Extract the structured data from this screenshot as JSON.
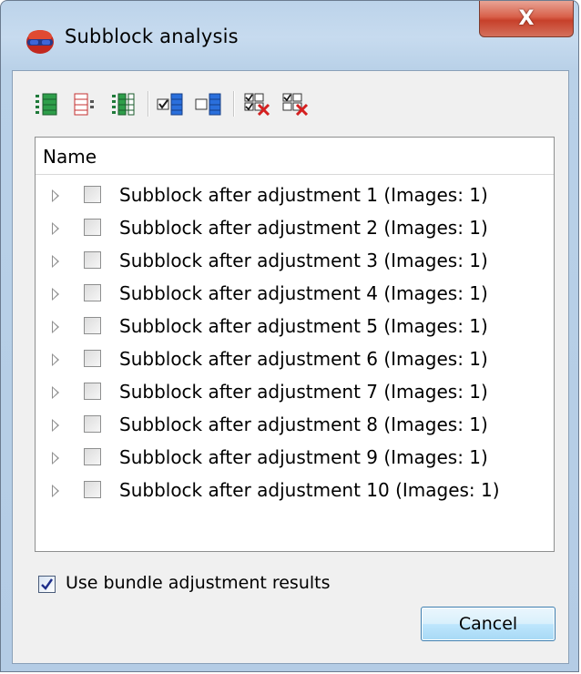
{
  "window": {
    "title": "Subblock analysis",
    "close_label": "X"
  },
  "toolbar": {
    "buttons": [
      {
        "icon": "expand-all-icon"
      },
      {
        "icon": "collapse-all-icon"
      },
      {
        "icon": "expand-tree-icon"
      },
      {
        "icon": "check-all-icon"
      },
      {
        "icon": "uncheck-all-icon"
      },
      {
        "icon": "check-selected-x-icon"
      },
      {
        "icon": "uncheck-selected-x-icon"
      }
    ]
  },
  "tree": {
    "header": "Name",
    "rows": [
      {
        "label": "Subblock after adjustment  1 (Images: 1)",
        "checked": false
      },
      {
        "label": "Subblock after adjustment  2 (Images: 1)",
        "checked": false
      },
      {
        "label": "Subblock after adjustment  3 (Images: 1)",
        "checked": false
      },
      {
        "label": "Subblock after adjustment  4 (Images: 1)",
        "checked": false
      },
      {
        "label": "Subblock after adjustment  5 (Images: 1)",
        "checked": false
      },
      {
        "label": "Subblock after adjustment  6 (Images: 1)",
        "checked": false
      },
      {
        "label": "Subblock after adjustment  7 (Images: 1)",
        "checked": false
      },
      {
        "label": "Subblock after adjustment  8 (Images: 1)",
        "checked": false
      },
      {
        "label": "Subblock after adjustment  9 (Images: 1)",
        "checked": false
      },
      {
        "label": "Subblock after adjustment  10 (Images: 1)",
        "checked": false
      }
    ]
  },
  "options": {
    "use_bundle_label": "Use bundle adjustment results",
    "use_bundle_checked": true
  },
  "buttons": {
    "cancel_label": "Cancel"
  },
  "colors": {
    "accent": "#3c7fb1",
    "close": "#c7402a",
    "icon_green": "#1f7a3a",
    "icon_blue": "#1f5fbf",
    "icon_red": "#d42020"
  }
}
